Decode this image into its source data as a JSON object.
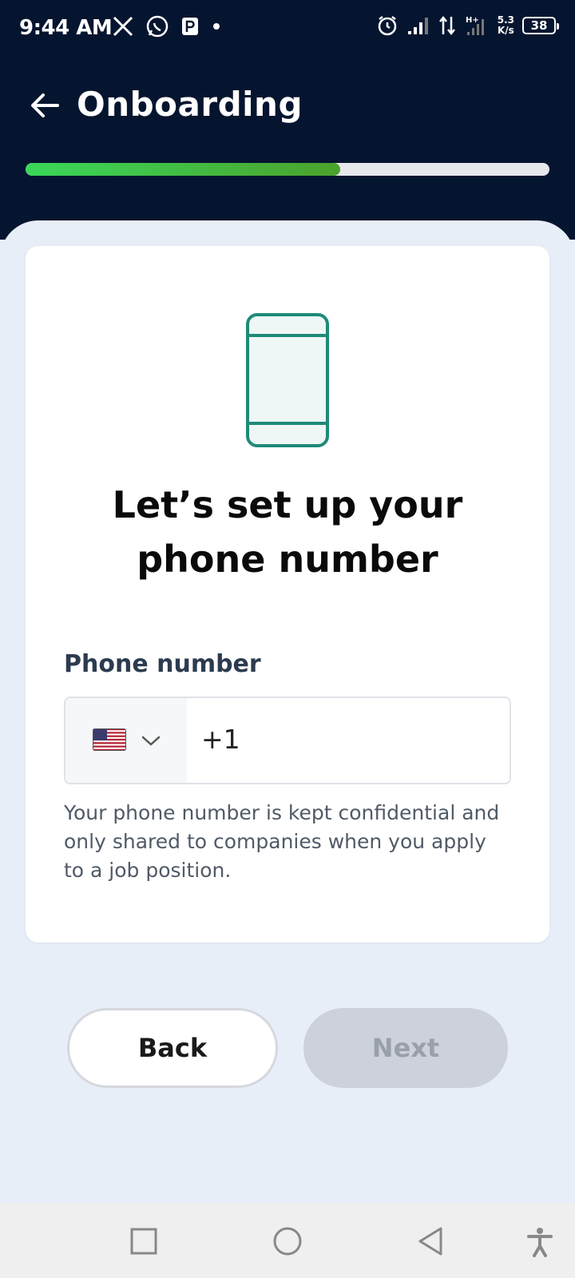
{
  "status_bar": {
    "time": "9:44 AM",
    "app_icons": [
      "x-icon",
      "whatsapp-icon",
      "parking-icon",
      "dot-icon"
    ],
    "net_speed_value": "5.3",
    "net_speed_unit": "K/s",
    "battery": "38"
  },
  "header": {
    "title": "Onboarding",
    "progress_percent": 60
  },
  "card": {
    "heading_line1": "Let’s set up your",
    "heading_line2": "phone number",
    "field_label": "Phone number",
    "country": "United States",
    "dial_code": "+1",
    "helper_text": "Your phone number is kept confidential and only shared to companies when you apply to a job position."
  },
  "buttons": {
    "back_label": "Back",
    "next_label": "Next"
  },
  "colors": {
    "header_bg": "#06152f",
    "progress": "#3ad85a",
    "accent_teal": "#1e8a78",
    "page_bg": "#e8eef7"
  }
}
